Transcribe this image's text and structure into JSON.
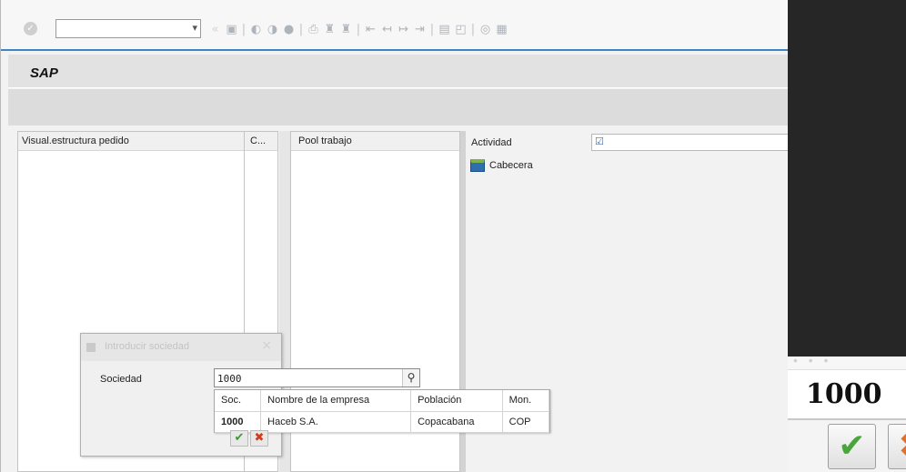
{
  "toolbar": {
    "command_field_value": "",
    "icons": [
      "enter-icon",
      "save-icon",
      "back-icon",
      "exit-icon",
      "cancel-icon",
      "print-icon",
      "find-icon",
      "find-next-icon",
      "first-page-icon",
      "previous-page-icon",
      "next-page-icon",
      "last-page-icon",
      "new-session-icon",
      "shortcut-icon",
      "help-icon",
      "customize-icon"
    ]
  },
  "header": {
    "title": "SAP"
  },
  "left_pane": {
    "header": "Visual.estructura pedido",
    "col2_header": "C..."
  },
  "middle_pane": {
    "header": "Pool trabajo"
  },
  "right_pane": {
    "activity_label": "Actividad",
    "activity_value": "",
    "item_label": "Cabecera"
  },
  "dialog": {
    "title": "Introducir sociedad",
    "field_label": "Sociedad",
    "field_value": "1000"
  },
  "f4_help": {
    "columns": [
      "Soc.",
      "Nombre de la empresa",
      "Población",
      "Mon."
    ],
    "rows": [
      {
        "soc": "1000",
        "nombre": "Haceb S.A.",
        "poblacion": "Copacabana",
        "mon": "COP"
      }
    ]
  },
  "zoom": {
    "field_value": "1000"
  },
  "colors": {
    "accent": "#3d86c6",
    "ok_green": "#4aa53a",
    "cancel_orange": "#e0702c"
  }
}
